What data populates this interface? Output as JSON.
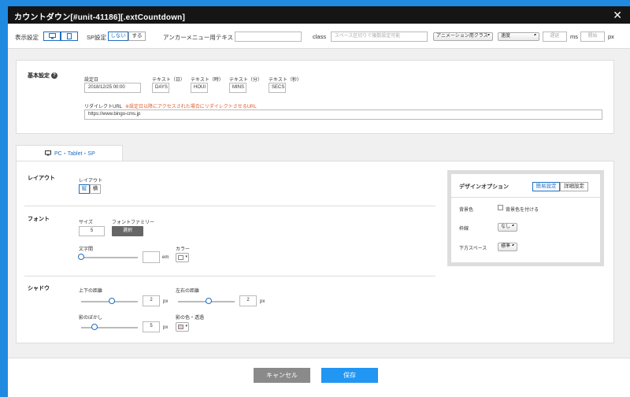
{
  "title": "カウントダウン[#unit-41186][.extCountdown]",
  "toolbar": {
    "display_label": "表示設定",
    "sp_label": "SP設定",
    "sp_off": "しない",
    "sp_on": "する",
    "anchor_label": "アンカーメニュー用テキスト",
    "anchor_value": "",
    "class_label": "class",
    "class_placeholder": "スペース区切りで複数設定可能",
    "animation_select": "アニメーション用クラス",
    "speed_select": "速度",
    "delay_placeholder": "遅延",
    "ms_label": "ms",
    "start_placeholder": "開始",
    "px_label": "px"
  },
  "basic": {
    "section_label": "基本設定",
    "date_label": "設定日",
    "date_value": "2018/12/25 00:00",
    "days_label": "テキスト（日）",
    "days_value": "DAYS",
    "hours_label": "テキスト（時）",
    "hours_value": "HOUI",
    "mins_label": "テキスト（分）",
    "mins_value": "MINS",
    "secs_label": "テキスト（秒）",
    "secs_value": "SECS",
    "redirect_label": "リダイレクトURL",
    "redirect_note": "※設定日以降にアクセスされた場合にリダイレクトさせるURL",
    "redirect_value": "https://www.bingo-cms.jp"
  },
  "tabs": [
    {
      "label": "PC・Tablet・SP"
    }
  ],
  "layout": {
    "section_label": "レイアウト",
    "field_label": "レイアウト",
    "vertical": "縦",
    "horizontal": "横"
  },
  "font": {
    "section_label": "フォント",
    "size_label": "サイズ",
    "size_value": "5",
    "family_label": "フォントファミリー",
    "family_button": "選択",
    "spacing_label": "文字間",
    "spacing_value": "",
    "spacing_unit": "em",
    "color_label": "カラー"
  },
  "shadow": {
    "section_label": "シャドウ",
    "vertical_label": "上下の距離",
    "vertical_value": "2",
    "horizontal_label": "左右の距離",
    "horizontal_value": "2",
    "blur_label": "影のぼかし",
    "blur_value": "5",
    "color_label": "影の色・透過",
    "unit": "px"
  },
  "design": {
    "title": "デザインオプション",
    "simple_tab": "簡易設定",
    "detail_tab": "詳細設定",
    "bg_label": "背景色",
    "bg_checkbox": "背景色を付ける",
    "border_label": "枠線",
    "border_value": "なし",
    "spacing_label": "下方スペース",
    "spacing_value": "標準"
  },
  "footer": {
    "cancel": "キャンセル",
    "save": "保存"
  },
  "colors": {
    "accent": "#1f8ae0",
    "save_button": "#2196f3",
    "cancel_button": "#8a8a8a",
    "note": "#e05a2b"
  }
}
